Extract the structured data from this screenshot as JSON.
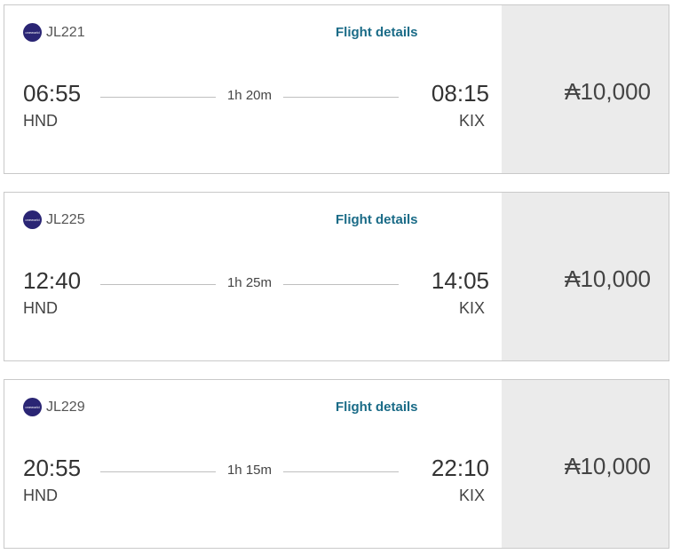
{
  "flights": [
    {
      "airline_logo_text": "oneworld",
      "flight_number": "JL221",
      "details_label": "Flight details",
      "departure_time": "06:55",
      "departure_airport": "HND",
      "duration": "1h 20m",
      "arrival_time": "08:15",
      "arrival_airport": "KIX",
      "price": "₳10,000"
    },
    {
      "airline_logo_text": "oneworld",
      "flight_number": "JL225",
      "details_label": "Flight details",
      "departure_time": "12:40",
      "departure_airport": "HND",
      "duration": "1h 25m",
      "arrival_time": "14:05",
      "arrival_airport": "KIX",
      "price": "₳10,000"
    },
    {
      "airline_logo_text": "oneworld",
      "flight_number": "JL229",
      "details_label": "Flight details",
      "departure_time": "20:55",
      "departure_airport": "HND",
      "duration": "1h 15m",
      "arrival_time": "22:10",
      "arrival_airport": "KIX",
      "price": "₳10,000"
    }
  ],
  "colors": {
    "link": "#1a6b87",
    "logo": "#2a2574",
    "price_panel": "#ebebeb",
    "border": "#c9c9c9"
  }
}
